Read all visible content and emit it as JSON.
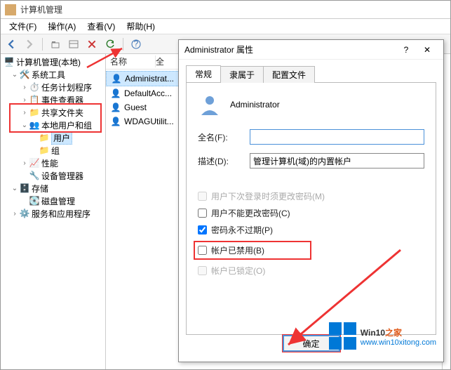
{
  "window": {
    "title": "计算机管理"
  },
  "menu": {
    "file": "文件(F)",
    "action": "操作(A)",
    "view": "查看(V)",
    "help": "帮助(H)"
  },
  "tree": {
    "root": "计算机管理(本地)",
    "systools": "系统工具",
    "task": "任务计划程序",
    "event": "事件查看器",
    "shared": "共享文件夹",
    "localusers": "本地用户和组",
    "users": "用户",
    "groups": "组",
    "perf": "性能",
    "devmgr": "设备管理器",
    "storage": "存储",
    "diskmgr": "磁盘管理",
    "services": "服务和应用程序"
  },
  "list": {
    "col_name": "名称",
    "col_full": "全",
    "items": {
      "admin": "Administrat...",
      "default": "DefaultAcc...",
      "guest": "Guest",
      "wdag": "WDAGUtilit..."
    }
  },
  "dlg": {
    "title": "Administrator 属性",
    "tabs": {
      "general": "常规",
      "memberof": "隶属于",
      "profile": "配置文件"
    },
    "username": "Administrator",
    "fullname_label": "全名(F):",
    "fullname_value": "",
    "desc_label": "描述(D):",
    "desc_value": "管理计算机(域)的内置帐户",
    "chk_nextlogin": "用户下次登录时须更改密码(M)",
    "chk_cantchange": "用户不能更改密码(C)",
    "chk_neverexp": "密码永不过期(P)",
    "chk_disabled": "帐户已禁用(B)",
    "chk_locked": "帐户已锁定(O)",
    "ok": "确定"
  },
  "watermark": {
    "brand_a": "Win10",
    "brand_b": "之家",
    "url": "www.win10xitong.com"
  }
}
